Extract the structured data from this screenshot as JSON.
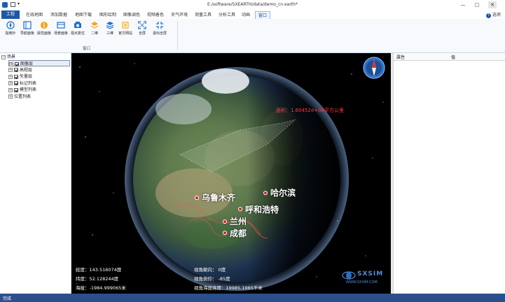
{
  "window": {
    "title": "E:/software/SXEARTH/data/demo_cn.earth*",
    "help_label": "选项",
    "minimize": "—",
    "maximize": "□",
    "close": "✕"
  },
  "ribbon_tabs": [
    {
      "label": "工程"
    },
    {
      "label": "在线地图"
    },
    {
      "label": "添加数据"
    },
    {
      "label": "地图下载"
    },
    {
      "label": "图形绘制"
    },
    {
      "label": "图像调色"
    },
    {
      "label": "视频着色"
    },
    {
      "label": "天气环境"
    },
    {
      "label": "测量工具"
    },
    {
      "label": "分析工具"
    },
    {
      "label": "动画"
    },
    {
      "label": "窗口"
    }
  ],
  "ribbon_buttons": [
    {
      "label": "指南针",
      "icon": "compass-icon"
    },
    {
      "label": "导航面板",
      "icon": "panel-icon"
    },
    {
      "label": "属性面板",
      "icon": "info-icon"
    },
    {
      "label": "场景面板",
      "icon": "scene-panel-icon"
    },
    {
      "label": "视点复位",
      "icon": "reset-view-icon"
    },
    {
      "label": "二维",
      "icon": "layers-2d-icon"
    },
    {
      "label": "三维",
      "icon": "layers-3d-icon"
    },
    {
      "label": "官方网站",
      "icon": "website-icon"
    },
    {
      "label": "全屏",
      "icon": "fullscreen-icon"
    },
    {
      "label": "退出全屏",
      "icon": "exit-fullscreen-icon"
    }
  ],
  "ribbon_group_label": "窗口",
  "tree": {
    "root": "场景",
    "items": [
      {
        "label": "图像层",
        "checked": true,
        "selected": true
      },
      {
        "label": "高程层",
        "checked": true,
        "selected": false
      },
      {
        "label": "矢量层",
        "checked": true,
        "selected": false
      },
      {
        "label": "标记列表",
        "checked": true,
        "selected": false
      },
      {
        "label": "模型列表",
        "checked": true,
        "selected": false
      },
      {
        "label": "位置列表",
        "checked": false,
        "selected": false
      }
    ]
  },
  "map": {
    "area_label": "面积：1.60452e+06平方公里",
    "cities": [
      {
        "name": "乌鲁木齐"
      },
      {
        "name": "哈尔滨"
      },
      {
        "name": "呼和浩特"
      },
      {
        "name": "兰州"
      },
      {
        "name": "成都"
      }
    ],
    "hud": {
      "longitude": "经度：143.516074度",
      "latitude": "纬度：52.128244度",
      "altitude": "海拔：-1984.999065米",
      "view_heading": "视角朝向：    0度",
      "view_pitch": "视角俯仰：    -85度",
      "view_height": "视角海拔高度：19985.1965千米"
    },
    "watermark": "SXSIM",
    "watermark_url": "WWW.SXSIM.COM"
  },
  "props": {
    "col_attr": "属性",
    "col_value": "值"
  },
  "status": {
    "text": "完成"
  },
  "colors": {
    "accent": "#1e57a8",
    "status_bar": "#2b4f8c",
    "area_line": "#ff3b3b"
  }
}
